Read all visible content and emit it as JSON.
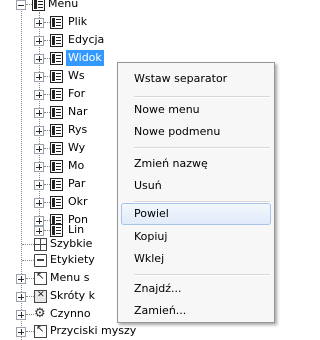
{
  "tree": {
    "items": [
      {
        "label": "Menu"
      },
      {
        "label": "Plik"
      },
      {
        "label": "Edycja"
      },
      {
        "label": "Widok"
      },
      {
        "label": "Ws"
      },
      {
        "label": "For"
      },
      {
        "label": "Nar"
      },
      {
        "label": "Rys"
      },
      {
        "label": "Wy"
      },
      {
        "label": "Mo"
      },
      {
        "label": "Par"
      },
      {
        "label": "Okr"
      },
      {
        "label": "Pon"
      },
      {
        "label": "Lin"
      },
      {
        "label": "Szybkie"
      },
      {
        "label": "Etykiety"
      },
      {
        "label": "Menu s"
      },
      {
        "label": "Skróty k"
      },
      {
        "label": "Czynno"
      },
      {
        "label": "Przyciski myszy"
      }
    ],
    "selected": "Widok"
  },
  "context_menu": {
    "items": [
      {
        "label": "Wstaw separator"
      },
      {
        "label": "Nowe menu"
      },
      {
        "label": "Nowe podmenu"
      },
      {
        "label": "Zmień nazwę"
      },
      {
        "label": "Usuń"
      },
      {
        "label": "Powiel"
      },
      {
        "label": "Kopiuj"
      },
      {
        "label": "Wklej"
      },
      {
        "label": "Znajdź..."
      },
      {
        "label": "Zamień..."
      }
    ],
    "hovered": "Powiel"
  },
  "colors": {
    "selection": "#3399ff",
    "menu_background": "#f7f7f7",
    "hover_border": "#a8c3ea"
  }
}
